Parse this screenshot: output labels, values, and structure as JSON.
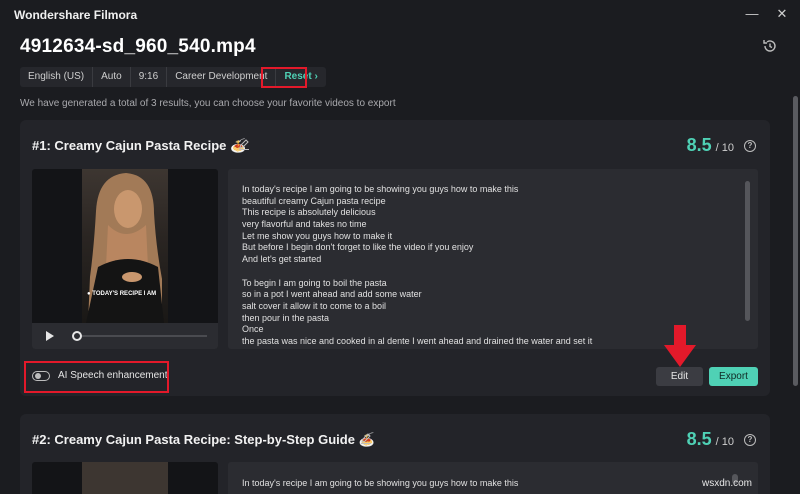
{
  "app": {
    "title": "Wondershare Filmora",
    "minimize_icon": "minimize-icon",
    "close_icon": "close-icon"
  },
  "header": {
    "file_name": "4912634-sd_960_540.mp4",
    "history_icon": "history-icon"
  },
  "tags": [
    "English (US)",
    "Auto",
    "9:16",
    "Career Development"
  ],
  "reset_label": "Reset",
  "info_text": "We have generated a total of 3 results, you can choose your favorite videos to export",
  "results": [
    {
      "title": "#1:  Creamy Cajun Pasta Recipe 🍝",
      "score": "8.5",
      "score_max": "/ 10",
      "caption": "● TODAY'S RECIPE I AM",
      "transcript": [
        "In today's recipe I am going to be showing you guys how to make this",
        "beautiful creamy Cajun pasta recipe",
        "This recipe is absolutely delicious",
        "very flavorful and takes no time",
        "Let me show you guys how to make it",
        "But before I begin don't forget to like the video if you enjoy",
        "And let's get started",
        "",
        "To begin I am going to boil the pasta",
        "so in a pot I went ahead and add some water",
        "salt cover it allow it to come to a boil",
        "then pour in the pasta",
        "Once",
        "the pasta was nice and cooked in al dente I went ahead and drained the water and set it"
      ],
      "ai_speech_label": "AI Speech enhancement",
      "ai_speech_enabled": false,
      "edit_label": "Edit",
      "export_label": "Export"
    },
    {
      "title": "#2:  Creamy Cajun Pasta Recipe: Step-by-Step Guide 🍝",
      "score": "8.5",
      "score_max": "/ 10",
      "transcript_first_line": "In today's recipe I am going to be showing you guys how to make this"
    }
  ],
  "watermark": "wsxdn.com",
  "colors": {
    "accent": "#4fd1b5",
    "highlight_red": "#e3192a",
    "background": "#1b1c20",
    "card": "#232429"
  }
}
